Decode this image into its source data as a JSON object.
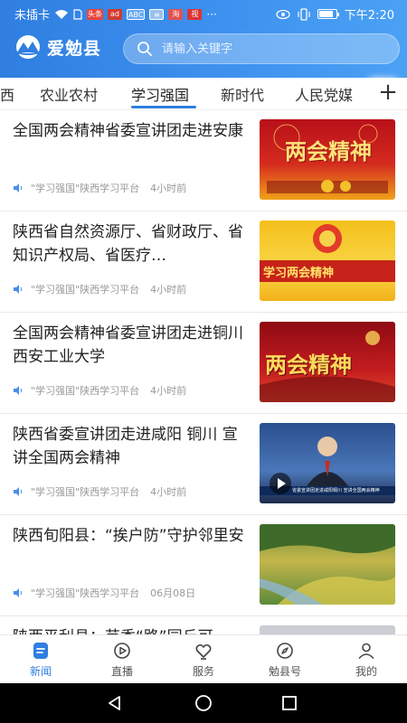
{
  "status_bar": {
    "carrier": "未插卡",
    "time": "下午2:20",
    "badges": [
      "头条",
      "ad",
      "ABC",
      "≡",
      "淘",
      "视"
    ],
    "badge_colors": [
      "#e8463c",
      "#d23a2e",
      "#6aa9f0",
      "#9ac1ee",
      "#e35050",
      "#d33"
    ]
  },
  "header": {
    "app_name": "爱勉县",
    "search_placeholder": "请输入关键字"
  },
  "tabs": {
    "items": [
      "西",
      "农业农村",
      "学习强国",
      "新时代",
      "人民党媒"
    ],
    "active": "学习强国",
    "more_label": "+"
  },
  "news": [
    {
      "title": "全国两会精神省委宣讲团走进安康",
      "source": "\"学习强国\"陕西学习平台",
      "time": "4小时前",
      "thumb_text": "两会精神"
    },
    {
      "title": "陕西省自然资源厅、省财政厅、省知识产权局、省医疗…",
      "source": "\"学习强国\"陕西学习平台",
      "time": "4小时前",
      "thumb_text": "学习两会精神"
    },
    {
      "title": "全国两会精神省委宣讲团走进铜川 西安工业大学",
      "source": "\"学习强国\"陕西学习平台",
      "time": "4小时前",
      "thumb_text": "两会精神"
    },
    {
      "title": "陕西省委宣讲团走进咸阳 铜川 宣讲全国两会精神",
      "source": "\"学习强国\"陕西学习平台",
      "time": "4小时前",
      "thumb_text": "省委宣讲团走进咸阳铜川 宣讲全国两会精神"
    },
    {
      "title": "陕西旬阳县：“挨户防”守护邻里安",
      "source": "\"学习强国\"陕西学习平台",
      "time": "06月08日",
      "thumb_text": ""
    },
    {
      "title": "陕西平利县：芸香“路”园丘可",
      "source": "",
      "time": "",
      "thumb_text": ""
    }
  ],
  "bottom_nav": [
    {
      "label": "新闻",
      "icon": "news-icon",
      "active": true
    },
    {
      "label": "直播",
      "icon": "live-icon",
      "active": false
    },
    {
      "label": "服务",
      "icon": "service-icon",
      "active": false
    },
    {
      "label": "勉县号",
      "icon": "compass-icon",
      "active": false
    },
    {
      "label": "我的",
      "icon": "user-icon",
      "active": false
    }
  ],
  "colors": {
    "accent": "#2f7ee0",
    "header_gradient_start": "#2f7ee0",
    "header_gradient_end": "#4aa1f4"
  }
}
